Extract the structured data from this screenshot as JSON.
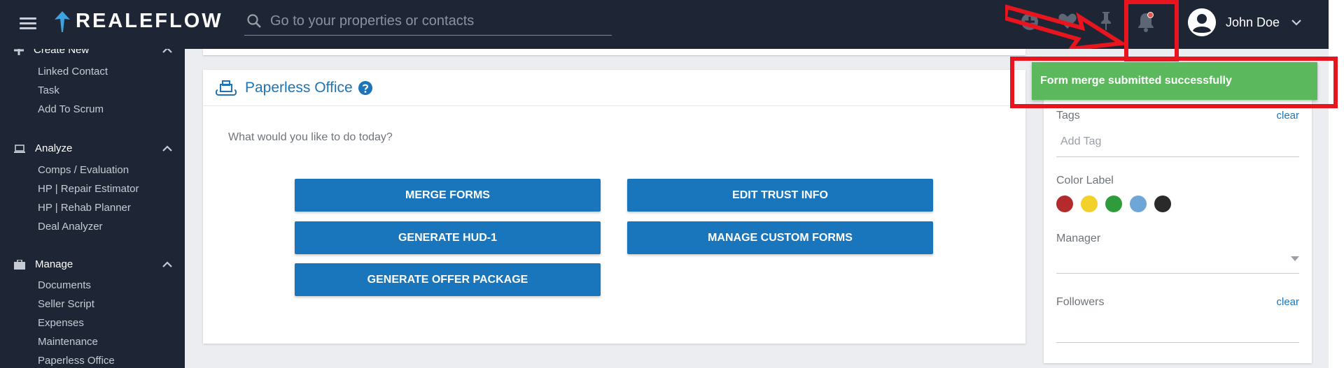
{
  "header": {
    "logo_text": "REALEFLOW",
    "search_placeholder": "Go to your properties or contacts",
    "user_name": "John Doe"
  },
  "sidebar": {
    "sections": [
      {
        "title": "Create New",
        "icon": "plus-icon",
        "items": [
          "Linked Contact",
          "Task",
          "Add To Scrum"
        ]
      },
      {
        "title": "Analyze",
        "icon": "laptop-icon",
        "items": [
          "Comps / Evaluation",
          "HP | Repair Estimator",
          "HP | Rehab Planner",
          "Deal Analyzer"
        ]
      },
      {
        "title": "Manage",
        "icon": "briefcase-icon",
        "items": [
          "Documents",
          "Seller Script",
          "Expenses",
          "Maintenance",
          "Paperless Office"
        ]
      }
    ]
  },
  "main": {
    "card_title": "Paperless Office",
    "prompt": "What would you like to do today?",
    "buttons": [
      "MERGE FORMS",
      "EDIT TRUST INFO",
      "GENERATE HUD-1",
      "MANAGE CUSTOM FORMS",
      "GENERATE OFFER PACKAGE"
    ]
  },
  "right_panel": {
    "tags_label": "Tags",
    "tags_clear": "clear",
    "tag_placeholder": "Add Tag",
    "color_label": "Color Label",
    "colors": [
      "#b52b2b",
      "#f3d12a",
      "#2e9c3a",
      "#6fa6d8",
      "#2a2a2a"
    ],
    "manager_label": "Manager",
    "followers_label": "Followers",
    "followers_clear": "clear"
  },
  "toast": {
    "message": "Form merge submitted successfully",
    "color": "#5cb85c"
  },
  "colors": {
    "topbar": "#1e2636",
    "accent": "#1976bc",
    "annotation_red": "#e8141e"
  }
}
